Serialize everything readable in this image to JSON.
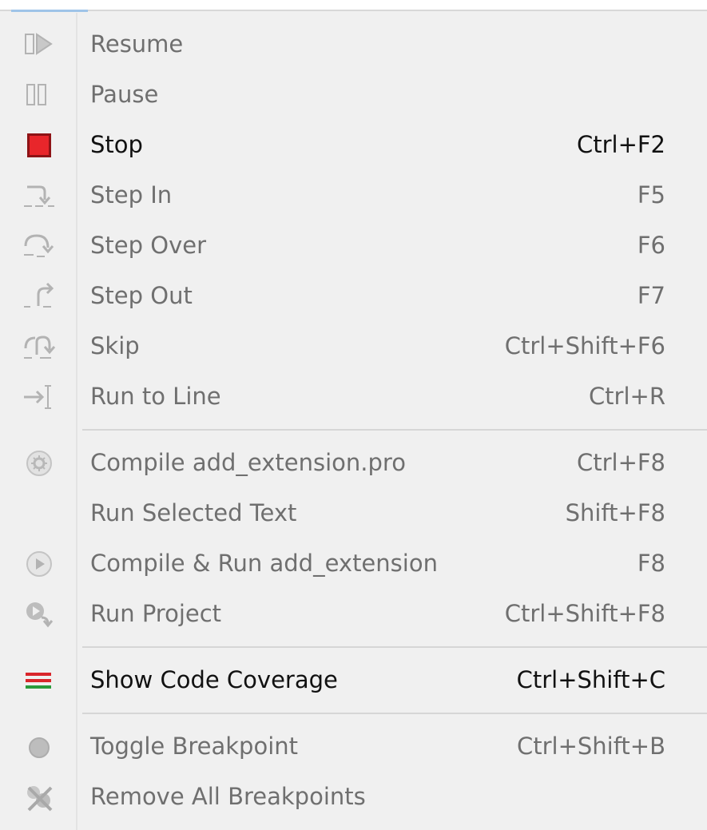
{
  "menu": {
    "items": [
      {
        "label": "Resume",
        "shortcut": "",
        "icon": "resume-icon",
        "enabled": false
      },
      {
        "label": "Pause",
        "shortcut": "",
        "icon": "pause-icon",
        "enabled": false
      },
      {
        "label": "Stop",
        "shortcut": "Ctrl+F2",
        "icon": "stop-icon",
        "enabled": true
      },
      {
        "label": "Step In",
        "shortcut": "F5",
        "icon": "step-in-icon",
        "enabled": false
      },
      {
        "label": "Step Over",
        "shortcut": "F6",
        "icon": "step-over-icon",
        "enabled": false
      },
      {
        "label": "Step Out",
        "shortcut": "F7",
        "icon": "step-out-icon",
        "enabled": false
      },
      {
        "label": "Skip",
        "shortcut": "Ctrl+Shift+F6",
        "icon": "skip-icon",
        "enabled": false
      },
      {
        "label": "Run to Line",
        "shortcut": "Ctrl+R",
        "icon": "run-to-line-icon",
        "enabled": false
      },
      {
        "label": "Compile add_extension.pro",
        "shortcut": "Ctrl+F8",
        "icon": "compile-icon",
        "enabled": false
      },
      {
        "label": "Run Selected Text",
        "shortcut": "Shift+F8",
        "icon": "",
        "enabled": false
      },
      {
        "label": "Compile & Run add_extension",
        "shortcut": "F8",
        "icon": "compile-run-icon",
        "enabled": false
      },
      {
        "label": "Run Project",
        "shortcut": "Ctrl+Shift+F8",
        "icon": "run-project-icon",
        "enabled": false
      },
      {
        "label": "Show Code Coverage",
        "shortcut": "Ctrl+Shift+C",
        "icon": "code-coverage-icon",
        "enabled": true
      },
      {
        "label": "Toggle Breakpoint",
        "shortcut": "Ctrl+Shift+B",
        "icon": "breakpoint-icon",
        "enabled": false
      },
      {
        "label": "Remove All Breakpoints",
        "shortcut": "",
        "icon": "remove-breakpoints-icon",
        "enabled": false
      }
    ]
  },
  "colors": {
    "menu_background": "#f0f0f0",
    "enabled_text": "#111111",
    "disabled_text": "#6f6f6f",
    "stop_red": "#e8262b",
    "coverage_red": "#d9262b",
    "coverage_green": "#2a9a3c",
    "separator": "#d6d6d6"
  }
}
